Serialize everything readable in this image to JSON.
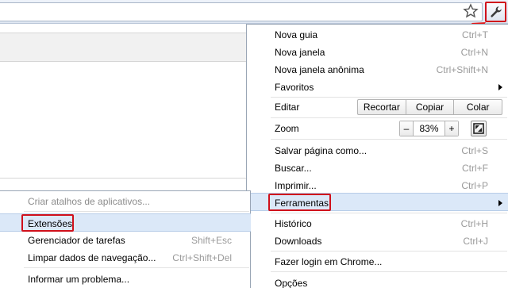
{
  "menu": {
    "nova_guia": {
      "label": "Nova guia",
      "shortcut": "Ctrl+T"
    },
    "nova_janela": {
      "label": "Nova janela",
      "shortcut": "Ctrl+N"
    },
    "nova_janela_anonima": {
      "label": "Nova janela anônima",
      "shortcut": "Ctrl+Shift+N"
    },
    "favoritos": {
      "label": "Favoritos"
    },
    "editar": {
      "label": "Editar",
      "recortar": "Recortar",
      "copiar": "Copiar",
      "colar": "Colar"
    },
    "zoom": {
      "label": "Zoom",
      "minus": "–",
      "value": "83%",
      "plus": "+"
    },
    "salvar": {
      "label": "Salvar página como...",
      "shortcut": "Ctrl+S"
    },
    "buscar": {
      "label": "Buscar...",
      "shortcut": "Ctrl+F"
    },
    "imprimir": {
      "label": "Imprimir...",
      "shortcut": "Ctrl+P"
    },
    "ferramentas": {
      "label": "Ferramentas"
    },
    "historico": {
      "label": "Histórico",
      "shortcut": "Ctrl+H"
    },
    "downloads": {
      "label": "Downloads",
      "shortcut": "Ctrl+J"
    },
    "login": {
      "label": "Fazer login em Chrome..."
    },
    "opcoes": {
      "label": "Opções"
    }
  },
  "submenu": {
    "criar_atalhos": {
      "label": "Criar atalhos de aplicativos..."
    },
    "extensoes": {
      "label": "Extensões"
    },
    "gerenciador": {
      "label": "Gerenciador de tarefas",
      "shortcut": "Shift+Esc"
    },
    "limpar": {
      "label": "Limpar dados de navegação...",
      "shortcut": "Ctrl+Shift+Del"
    },
    "informar": {
      "label": "Informar um problema..."
    }
  },
  "colors": {
    "highlight_box": "#d0101b",
    "hover": "#dbe8f8"
  },
  "icons": {
    "bookmark": "star-icon",
    "menu": "wrench-icon",
    "fullscreen": "fullscreen-icon"
  }
}
